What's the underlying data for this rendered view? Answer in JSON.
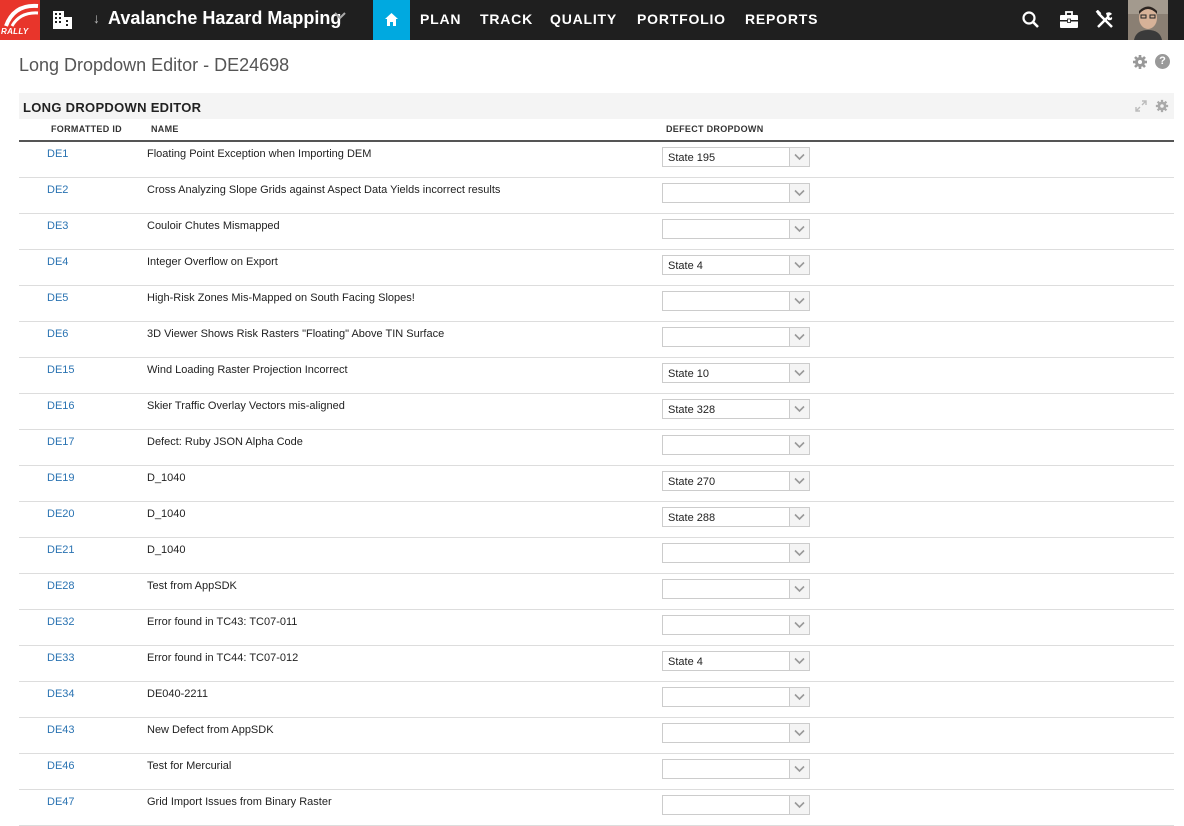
{
  "brand": {
    "logo_text": "RALLY",
    "accent": "#00a9e0",
    "logo_color": "#e8352b"
  },
  "header": {
    "project_name": "Avalanche Hazard Mapping",
    "nav": [
      "PLAN",
      "TRACK",
      "QUALITY",
      "PORTFOLIO",
      "REPORTS"
    ],
    "icons": [
      "home-icon",
      "search-icon",
      "briefcase-icon",
      "tools-icon",
      "user-avatar"
    ]
  },
  "page": {
    "title": "Long Dropdown Editor - DE24698"
  },
  "panel": {
    "title": "LONG DROPDOWN EDITOR",
    "columns": [
      "FORMATTED ID",
      "NAME",
      "DEFECT DROPDOWN"
    ]
  },
  "rows": [
    {
      "id": "DE1",
      "name": "Floating Point Exception when Importing DEM",
      "dropdown": "State 195"
    },
    {
      "id": "DE2",
      "name": "Cross Analyzing Slope Grids against Aspect Data Yields incorrect results",
      "dropdown": ""
    },
    {
      "id": "DE3",
      "name": "Couloir Chutes Mismapped",
      "dropdown": ""
    },
    {
      "id": "DE4",
      "name": "Integer Overflow on Export",
      "dropdown": "State 4"
    },
    {
      "id": "DE5",
      "name": "High-Risk Zones Mis-Mapped on South Facing Slopes!",
      "dropdown": ""
    },
    {
      "id": "DE6",
      "name": "3D Viewer Shows Risk Rasters \"Floating\" Above TIN Surface",
      "dropdown": ""
    },
    {
      "id": "DE15",
      "name": "Wind Loading Raster Projection Incorrect",
      "dropdown": "State 10"
    },
    {
      "id": "DE16",
      "name": "Skier Traffic Overlay Vectors mis-aligned",
      "dropdown": "State 328"
    },
    {
      "id": "DE17",
      "name": "Defect: Ruby JSON Alpha Code",
      "dropdown": ""
    },
    {
      "id": "DE19",
      "name": "D_1040",
      "dropdown": "State 270"
    },
    {
      "id": "DE20",
      "name": "D_1040",
      "dropdown": "State 288"
    },
    {
      "id": "DE21",
      "name": "D_1040",
      "dropdown": ""
    },
    {
      "id": "DE28",
      "name": "Test from AppSDK",
      "dropdown": ""
    },
    {
      "id": "DE32",
      "name": "Error found in TC43: TC07-011",
      "dropdown": ""
    },
    {
      "id": "DE33",
      "name": "Error found in TC44: TC07-012",
      "dropdown": "State 4"
    },
    {
      "id": "DE34",
      "name": "DE040-2211",
      "dropdown": ""
    },
    {
      "id": "DE43",
      "name": "New Defect from AppSDK",
      "dropdown": ""
    },
    {
      "id": "DE46",
      "name": "Test for Mercurial",
      "dropdown": ""
    },
    {
      "id": "DE47",
      "name": "Grid Import Issues from Binary Raster",
      "dropdown": ""
    }
  ]
}
